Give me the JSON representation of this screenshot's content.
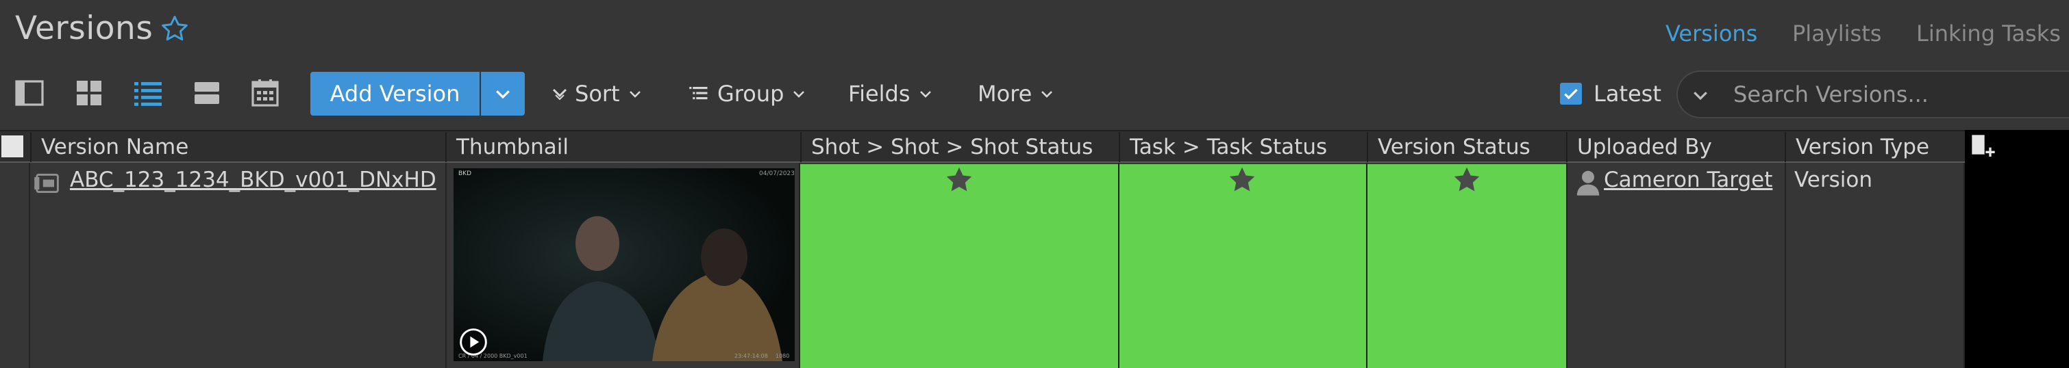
{
  "page": {
    "title": "Versions",
    "favorite_icon": "star-outline-icon"
  },
  "top_tabs": {
    "versions": "Versions",
    "playlists": "Playlists",
    "linking_tasks": "Linking Tasks"
  },
  "view_modes": [
    "sidebar-icon",
    "grid-icon",
    "list-icon",
    "rows-icon",
    "calendar-icon"
  ],
  "toolbar": {
    "add_version": "Add Version",
    "sort": "Sort",
    "group": "Group",
    "fields": "Fields",
    "more": "More",
    "latest": "Latest",
    "latest_checked": true,
    "search_placeholder": "Search Versions..."
  },
  "table": {
    "columns": [
      "Version Name",
      "Thumbnail",
      "Shot > Shot > Shot Status",
      "Task > Task Status",
      "Version Status",
      "Uploaded By",
      "Version Type"
    ],
    "rows": [
      {
        "version_name": "ABC_123_1234_BKD_v001_DNxHD",
        "thumbnail_overlay": {
          "top_left": "BKD",
          "top_right": "04/07/2023",
          "bottom_left": "CR / 04 / 2000 BKD_v001",
          "bottom_mid": "23:47:14:08",
          "bottom_right": "1080"
        },
        "shot_status": "star-icon",
        "task_status": "star-icon",
        "version_status": "star-icon",
        "uploaded_by": "Cameron Target",
        "version_type": "Version"
      }
    ]
  },
  "colors": {
    "accent": "#3f93d9",
    "status_green": "#62d24f",
    "background": "#363636"
  }
}
